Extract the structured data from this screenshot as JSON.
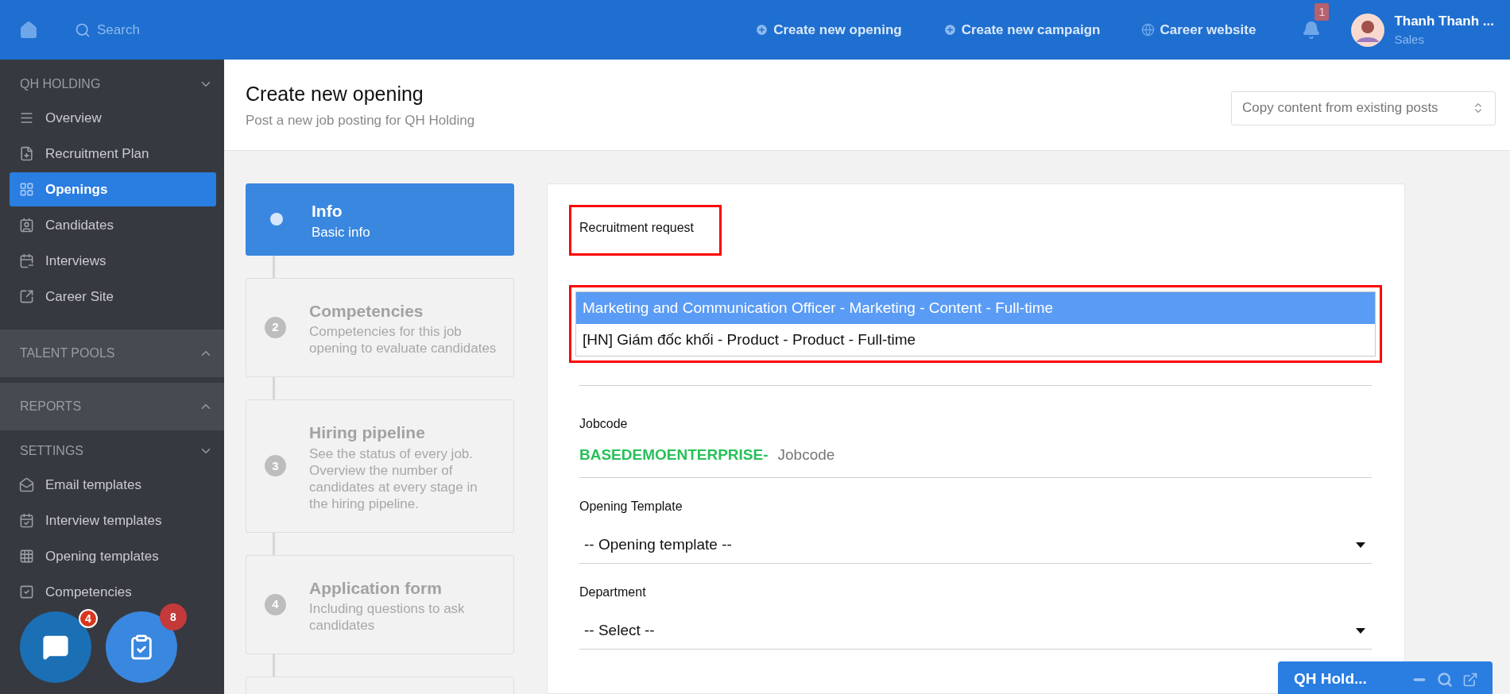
{
  "topbar": {
    "search_placeholder": "Search",
    "actions": [
      "Create new opening",
      "Create new campaign",
      "Career website"
    ],
    "notification_count": "1",
    "user": {
      "name": "Thanh Thanh ...",
      "role": "Sales"
    }
  },
  "sidebar": {
    "sections": [
      {
        "title": "QH HOLDING",
        "expanded": true,
        "items": [
          {
            "label": "Overview",
            "selected": false
          },
          {
            "label": "Recruitment Plan",
            "selected": false
          },
          {
            "label": "Openings",
            "selected": true
          },
          {
            "label": "Candidates",
            "selected": false
          },
          {
            "label": "Interviews",
            "selected": false
          },
          {
            "label": "Career Site",
            "selected": false
          }
        ]
      },
      {
        "title": "TALENT POOLS",
        "expanded": false
      },
      {
        "title": "REPORTS",
        "expanded": false
      },
      {
        "title": "SETTINGS",
        "expanded": true,
        "items": [
          {
            "label": "Email templates",
            "selected": false
          },
          {
            "label": "Interview templates",
            "selected": false
          },
          {
            "label": "Opening templates",
            "selected": false
          },
          {
            "label": "Competencies",
            "selected": false
          }
        ]
      }
    ]
  },
  "header": {
    "title": "Create new opening",
    "subtitle": "Post a new job posting for QH Holding",
    "copy_select": "Copy content from existing posts"
  },
  "steps": [
    {
      "title": "Info",
      "description": "Basic info",
      "selected": true
    },
    {
      "number": "2",
      "title": "Competencies",
      "description": "Competencies for this job opening to evaluate candidates",
      "selected": false
    },
    {
      "number": "3",
      "title": "Hiring pipeline",
      "description": "See the status of every job. Overview the number of candidates at every stage in the hiring pipeline.",
      "selected": false
    },
    {
      "number": "4",
      "title": "Application form",
      "description": "Including questions to ask candidates",
      "selected": false
    }
  ],
  "form": {
    "recruitment_request": {
      "label": "Recruitment request",
      "highlighted": true,
      "list_highlighted": true,
      "options": [
        {
          "label": "Marketing and Communication Officer - Marketing - Content - Full-time",
          "selected": true
        },
        {
          "label": "[HN] Giám đốc khối - Product - Product - Full-time",
          "selected": false
        }
      ]
    },
    "jobcode": {
      "label": "Jobcode",
      "prefix": "BASEDEMOENTERPRISE-",
      "placeholder": "Jobcode"
    },
    "opening_template": {
      "label": "Opening Template",
      "value": "-- Opening template --"
    },
    "department": {
      "label": "Department",
      "value": "-- Select --"
    }
  },
  "floating_buttons": [
    {
      "kind": "chat",
      "badge": "4"
    },
    {
      "kind": "tasks",
      "badge": "8"
    }
  ],
  "chat_bar": {
    "title": "QH Hold..."
  }
}
